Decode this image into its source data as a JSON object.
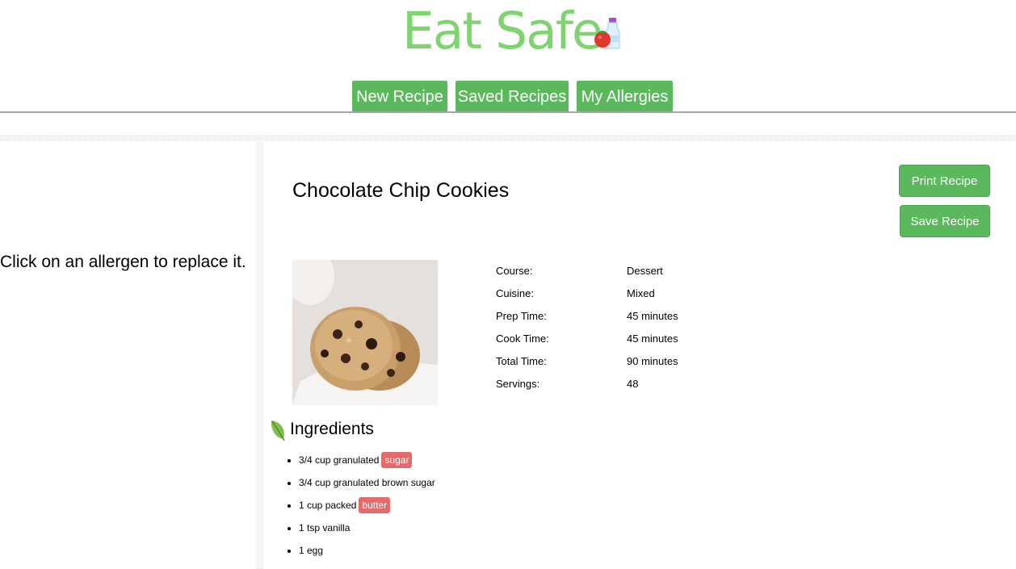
{
  "colors": {
    "brand": "#7ed56f",
    "accent_green": "#5cb85c",
    "allergen_red": "#e36b6b"
  },
  "header": {
    "title": "Eat Safe",
    "logo_icon": "tomato-milk-icon"
  },
  "nav": {
    "tabs": [
      {
        "label": "New Recipe"
      },
      {
        "label": "Saved Recipes"
      },
      {
        "label": "My Allergies"
      }
    ]
  },
  "left_panel": {
    "message": "Click on an allergen to replace it."
  },
  "recipe": {
    "title": "Chocolate Chip Cookies",
    "print_label": "Print Recipe",
    "save_label": "Save Recipe",
    "image_subject": "chocolate chip cookies",
    "details": [
      {
        "label": "Course:",
        "value": "Dessert"
      },
      {
        "label": "Cuisine:",
        "value": "Mixed"
      },
      {
        "label": "Prep Time:",
        "value": "45 minutes"
      },
      {
        "label": "Cook Time:",
        "value": "45 minutes"
      },
      {
        "label": "Total Time:",
        "value": "90 minutes"
      },
      {
        "label": "Servings:",
        "value": "48"
      }
    ],
    "ingredients_heading": "Ingredients",
    "ingredients_icon": "leaf-icon",
    "ingredients": [
      {
        "text": "3/4 cup granulated",
        "allergen": "sugar"
      },
      {
        "text": "3/4 cup granulated brown sugar",
        "allergen": ""
      },
      {
        "text": "1 cup packed",
        "allergen": "butter"
      },
      {
        "text": "1 tsp vanilla",
        "allergen": ""
      },
      {
        "text": "1 egg",
        "allergen": ""
      }
    ]
  }
}
